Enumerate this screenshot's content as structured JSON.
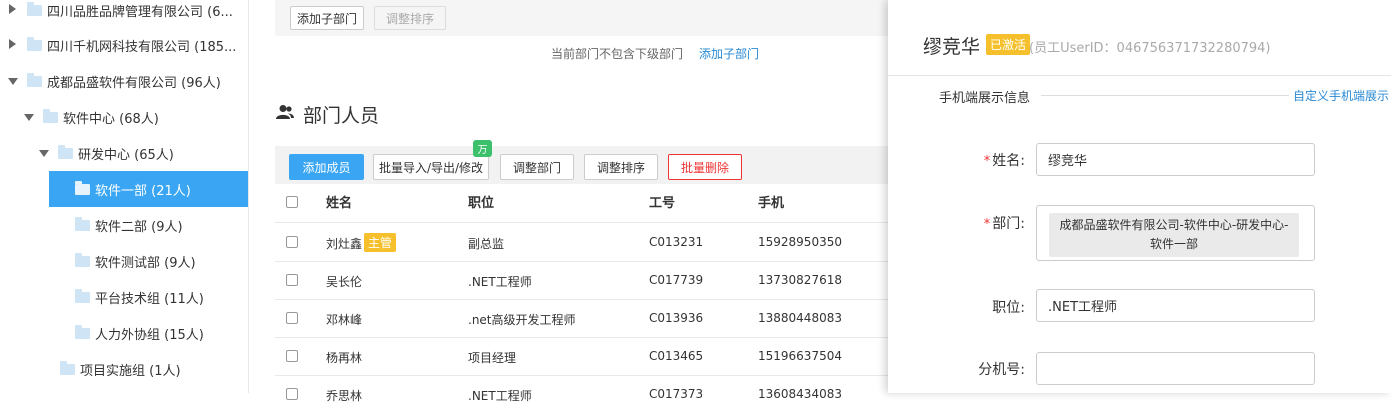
{
  "tree": {
    "items": [
      {
        "label": "四川品胜品牌管理有限公司 (6...",
        "expanded": false
      },
      {
        "label": "四川千机网科技有限公司 (185...",
        "expanded": false
      },
      {
        "label": "成都品盛软件有限公司 (96人)",
        "expanded": true
      },
      {
        "label": "软件中心 (68人)",
        "expanded": true
      },
      {
        "label": "研发中心 (65人)",
        "expanded": true
      },
      {
        "label": "软件一部 (21人)",
        "selected": true
      },
      {
        "label": "软件二部 (9人)"
      },
      {
        "label": "软件测试部 (9人)"
      },
      {
        "label": "平台技术组 (11人)"
      },
      {
        "label": "人力外协组 (15人)"
      },
      {
        "label": "项目实施组 (1人)"
      }
    ]
  },
  "subdept": {
    "add_label": "添加子部门",
    "sort_label": "调整排序",
    "empty_text": "当前部门不包含下级部门",
    "add_link": "添加子部门"
  },
  "members": {
    "title": "部门人员",
    "buttons": {
      "add": "添加成员",
      "batch": "批量导入/导出/修改",
      "batch_badge": "万",
      "adjust_dept": "调整部门",
      "adjust_sort": "调整排序",
      "batch_delete": "批量删除"
    },
    "columns": [
      "姓名",
      "职位",
      "工号",
      "手机"
    ],
    "rows": [
      {
        "name": "刘灶鑫",
        "tag": "主管",
        "title": "副总监",
        "id": "C013231",
        "phone": "15928950350"
      },
      {
        "name": "吴长伦",
        "title": ".NET工程师",
        "id": "C017739",
        "phone": "13730827618"
      },
      {
        "name": "邓林峰",
        "title": ".net高级开发工程师",
        "id": "C013936",
        "phone": "13880448083"
      },
      {
        "name": "杨再林",
        "title": "项目经理",
        "id": "C013465",
        "phone": "15196637504"
      },
      {
        "name": "乔思林",
        "title": ".NET工程师",
        "id": "C017373",
        "phone": "13608434083"
      }
    ]
  },
  "panel": {
    "name": "缪竞华",
    "status": "已激活",
    "userid": "(员工UserID：046756371732280794)",
    "section": "手机端展示信息",
    "custom_link": "自定义手机端展示",
    "fields": {
      "name_label": "姓名:",
      "name_value": "缪竞华",
      "dept_label": "部门:",
      "dept_value": "成都品盛软件有限公司-软件中心-研发中心-软件一部",
      "title_label": "职位:",
      "title_value": ".NET工程师",
      "ext_label": "分机号:",
      "ext_value": ""
    }
  },
  "colors": {
    "accent": "#3aa6f3",
    "danger": "#e33333",
    "badge_yellow": "#f5c02b",
    "badge_green": "#3cc06c"
  }
}
